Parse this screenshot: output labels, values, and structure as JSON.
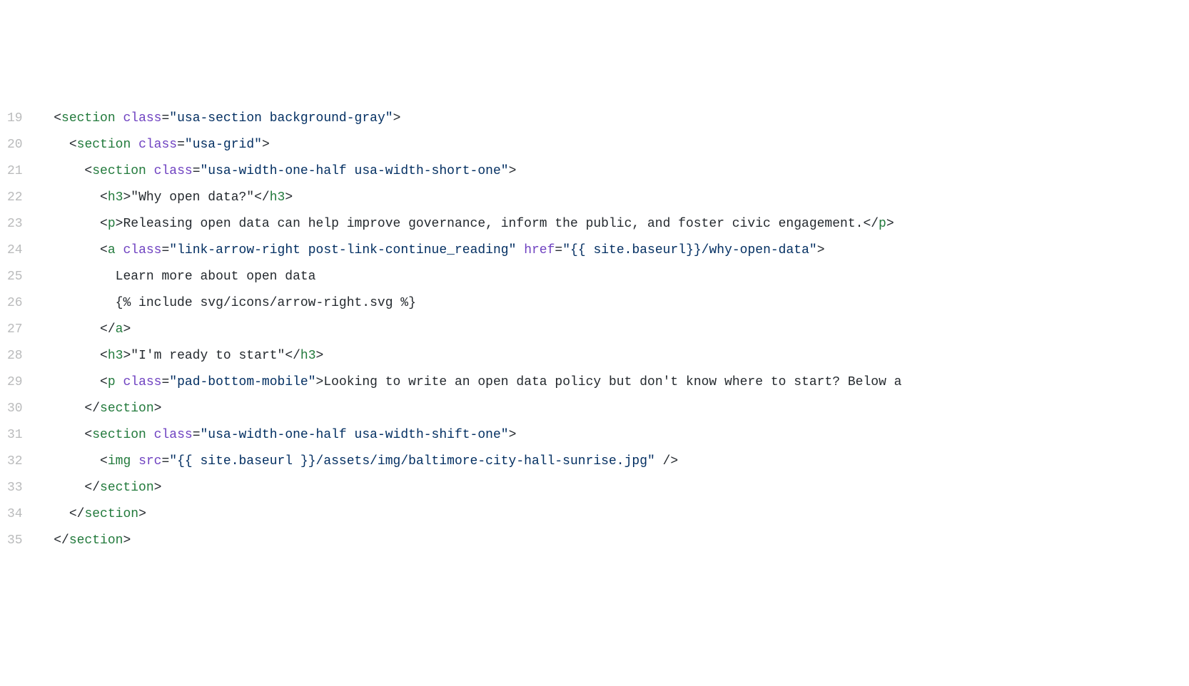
{
  "gutter": {
    "start": 19,
    "end": 35
  },
  "lines": [
    {
      "indent": 1,
      "tokens": [
        {
          "t": "punc",
          "v": "<"
        },
        {
          "t": "tag",
          "v": "section"
        },
        {
          "t": "punc",
          "v": " "
        },
        {
          "t": "attr",
          "v": "class"
        },
        {
          "t": "punc",
          "v": "="
        },
        {
          "t": "str",
          "v": "\"usa-section background-gray\""
        },
        {
          "t": "punc",
          "v": ">"
        }
      ]
    },
    {
      "indent": 2,
      "tokens": [
        {
          "t": "punc",
          "v": "<"
        },
        {
          "t": "tag",
          "v": "section"
        },
        {
          "t": "punc",
          "v": " "
        },
        {
          "t": "attr",
          "v": "class"
        },
        {
          "t": "punc",
          "v": "="
        },
        {
          "t": "str",
          "v": "\"usa-grid\""
        },
        {
          "t": "punc",
          "v": ">"
        }
      ]
    },
    {
      "indent": 3,
      "tokens": [
        {
          "t": "punc",
          "v": "<"
        },
        {
          "t": "tag",
          "v": "section"
        },
        {
          "t": "punc",
          "v": " "
        },
        {
          "t": "attr",
          "v": "class"
        },
        {
          "t": "punc",
          "v": "="
        },
        {
          "t": "str",
          "v": "\"usa-width-one-half usa-width-short-one\""
        },
        {
          "t": "punc",
          "v": ">"
        }
      ]
    },
    {
      "indent": 4,
      "tokens": [
        {
          "t": "punc",
          "v": "<"
        },
        {
          "t": "tag",
          "v": "h3"
        },
        {
          "t": "punc",
          "v": ">"
        },
        {
          "t": "text",
          "v": "\"Why open data?\""
        },
        {
          "t": "punc",
          "v": "</"
        },
        {
          "t": "tag",
          "v": "h3"
        },
        {
          "t": "punc",
          "v": ">"
        }
      ]
    },
    {
      "indent": 4,
      "tokens": [
        {
          "t": "punc",
          "v": "<"
        },
        {
          "t": "tag",
          "v": "p"
        },
        {
          "t": "punc",
          "v": ">"
        },
        {
          "t": "text",
          "v": "Releasing open data can help improve governance, inform the public, and foster civic engagement."
        },
        {
          "t": "punc",
          "v": "</"
        },
        {
          "t": "tag",
          "v": "p"
        },
        {
          "t": "punc",
          "v": ">"
        }
      ]
    },
    {
      "indent": 4,
      "tokens": [
        {
          "t": "punc",
          "v": "<"
        },
        {
          "t": "tag",
          "v": "a"
        },
        {
          "t": "punc",
          "v": " "
        },
        {
          "t": "attr",
          "v": "class"
        },
        {
          "t": "punc",
          "v": "="
        },
        {
          "t": "str",
          "v": "\"link-arrow-right post-link-continue_reading\""
        },
        {
          "t": "punc",
          "v": " "
        },
        {
          "t": "attr",
          "v": "href"
        },
        {
          "t": "punc",
          "v": "="
        },
        {
          "t": "str",
          "v": "\"{{ site.baseurl}}/why-open-data\""
        },
        {
          "t": "punc",
          "v": ">"
        }
      ]
    },
    {
      "indent": 5,
      "tokens": [
        {
          "t": "text",
          "v": "Learn more about open data"
        }
      ]
    },
    {
      "indent": 5,
      "tokens": [
        {
          "t": "text",
          "v": "{% include svg/icons/arrow-right.svg %}"
        }
      ]
    },
    {
      "indent": 4,
      "tokens": [
        {
          "t": "punc",
          "v": "</"
        },
        {
          "t": "tag",
          "v": "a"
        },
        {
          "t": "punc",
          "v": ">"
        }
      ]
    },
    {
      "indent": 4,
      "tokens": [
        {
          "t": "punc",
          "v": "<"
        },
        {
          "t": "tag",
          "v": "h3"
        },
        {
          "t": "punc",
          "v": ">"
        },
        {
          "t": "text",
          "v": "\"I'm ready to start\""
        },
        {
          "t": "punc",
          "v": "</"
        },
        {
          "t": "tag",
          "v": "h3"
        },
        {
          "t": "punc",
          "v": ">"
        }
      ]
    },
    {
      "indent": 4,
      "tokens": [
        {
          "t": "punc",
          "v": "<"
        },
        {
          "t": "tag",
          "v": "p"
        },
        {
          "t": "punc",
          "v": " "
        },
        {
          "t": "attr",
          "v": "class"
        },
        {
          "t": "punc",
          "v": "="
        },
        {
          "t": "str",
          "v": "\"pad-bottom-mobile\""
        },
        {
          "t": "punc",
          "v": ">"
        },
        {
          "t": "text",
          "v": "Looking to write an open data policy but don't know where to start? Below a"
        }
      ]
    },
    {
      "indent": 3,
      "tokens": [
        {
          "t": "punc",
          "v": "</"
        },
        {
          "t": "tag",
          "v": "section"
        },
        {
          "t": "punc",
          "v": ">"
        }
      ]
    },
    {
      "indent": 3,
      "tokens": [
        {
          "t": "punc",
          "v": "<"
        },
        {
          "t": "tag",
          "v": "section"
        },
        {
          "t": "punc",
          "v": " "
        },
        {
          "t": "attr",
          "v": "class"
        },
        {
          "t": "punc",
          "v": "="
        },
        {
          "t": "str",
          "v": "\"usa-width-one-half usa-width-shift-one\""
        },
        {
          "t": "punc",
          "v": ">"
        }
      ]
    },
    {
      "indent": 4,
      "tokens": [
        {
          "t": "punc",
          "v": "<"
        },
        {
          "t": "tag",
          "v": "img"
        },
        {
          "t": "punc",
          "v": " "
        },
        {
          "t": "attr",
          "v": "src"
        },
        {
          "t": "punc",
          "v": "="
        },
        {
          "t": "str",
          "v": "\"{{ site.baseurl }}/assets/img/baltimore-city-hall-sunrise.jpg\""
        },
        {
          "t": "punc",
          "v": " />"
        }
      ]
    },
    {
      "indent": 3,
      "tokens": [
        {
          "t": "punc",
          "v": "</"
        },
        {
          "t": "tag",
          "v": "section"
        },
        {
          "t": "punc",
          "v": ">"
        }
      ]
    },
    {
      "indent": 2,
      "tokens": [
        {
          "t": "punc",
          "v": "</"
        },
        {
          "t": "tag",
          "v": "section"
        },
        {
          "t": "punc",
          "v": ">"
        }
      ]
    },
    {
      "indent": 1,
      "tokens": [
        {
          "t": "punc",
          "v": "</"
        },
        {
          "t": "tag",
          "v": "section"
        },
        {
          "t": "punc",
          "v": ">"
        }
      ]
    }
  ]
}
